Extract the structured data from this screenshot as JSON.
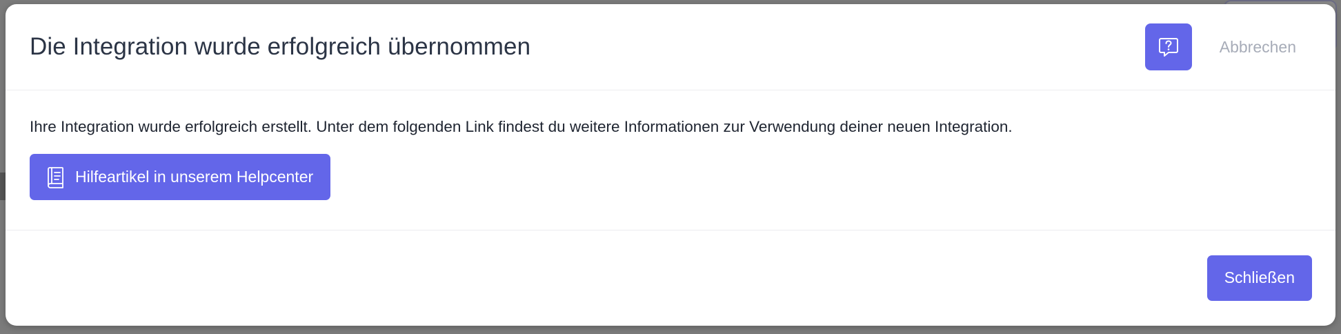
{
  "modal": {
    "title": "Die Integration wurde erfolgreich übernommen",
    "help_icon": "chat-question-icon",
    "cancel_label": "Abbrechen",
    "body_text": "Ihre Integration wurde erfolgreich erstellt. Unter dem folgenden Link findest du weitere Informationen zur Verwendung deiner neuen Integration.",
    "help_article_label": "Hilfeartikel in unserem Helpcenter",
    "help_article_icon": "book-icon",
    "close_label": "Schließen"
  },
  "colors": {
    "accent": "#6366e9",
    "title_text": "#2b3445",
    "muted_text": "#a7acb8",
    "overlay": "#7b7b7b"
  }
}
